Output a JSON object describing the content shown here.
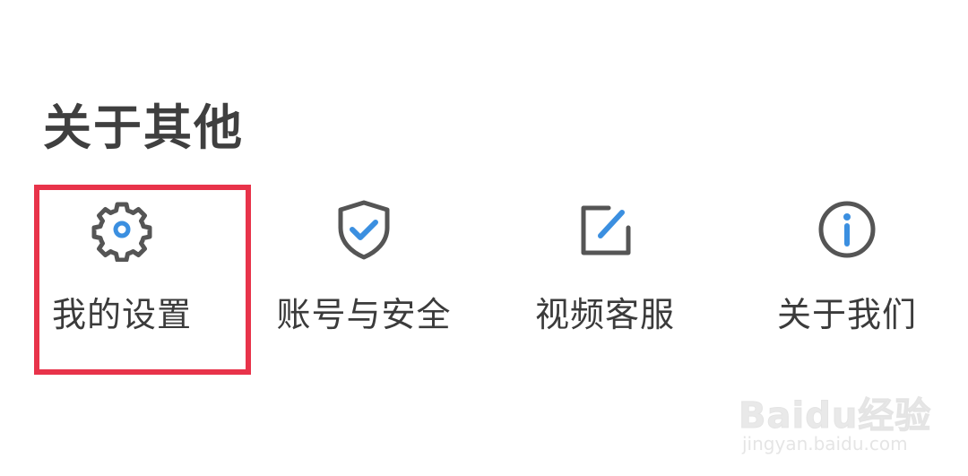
{
  "section": {
    "title": "关于其他"
  },
  "tiles": [
    {
      "label": "我的设置",
      "icon": "gear-icon"
    },
    {
      "label": "账号与安全",
      "icon": "shield-check-icon"
    },
    {
      "label": "视频客服",
      "icon": "edit-icon"
    },
    {
      "label": "关于我们",
      "icon": "info-icon"
    }
  ],
  "colors": {
    "icon_stroke": "#555555",
    "icon_accent": "#3b8fe0",
    "highlight": "#e8334a",
    "text": "#3b3b3b"
  },
  "watermark": {
    "brand": "Baidu经验",
    "url": "jingyan.baidu.com"
  }
}
